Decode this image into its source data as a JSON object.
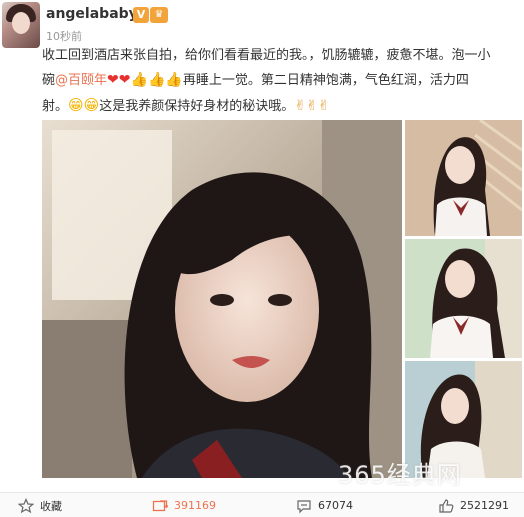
{
  "post": {
    "username": "angelababy",
    "verified_badge": "V",
    "crown_badge": "♛",
    "timestamp": "10秒前",
    "text_line1": "收工回到酒店来张自拍，给你们看看最近的我。，饥肠辘辘，疲惫不堪。泡一小",
    "text_line2_before": "碗",
    "mention": "@百颐年",
    "text_line2_after": "再睡上一觉。第二日精神饱满，气色红润，活力四",
    "text_line3_before": "射。",
    "text_line3_after": "这是我养颜保持好身材的秘诀哦。",
    "emoji": {
      "heart": "❤",
      "thumb": "👍",
      "grin": "😁",
      "victory": "✌"
    },
    "watermark": "365经典网"
  },
  "actions": {
    "favorite_label": "收藏",
    "repost_count": "391169",
    "comment_count": "67074",
    "like_count": "2521291"
  },
  "colors": {
    "accent": "#eb7350",
    "badge": "#f2a33a"
  },
  "icons": [
    "star-icon",
    "repost-icon",
    "comment-icon",
    "like-icon"
  ]
}
